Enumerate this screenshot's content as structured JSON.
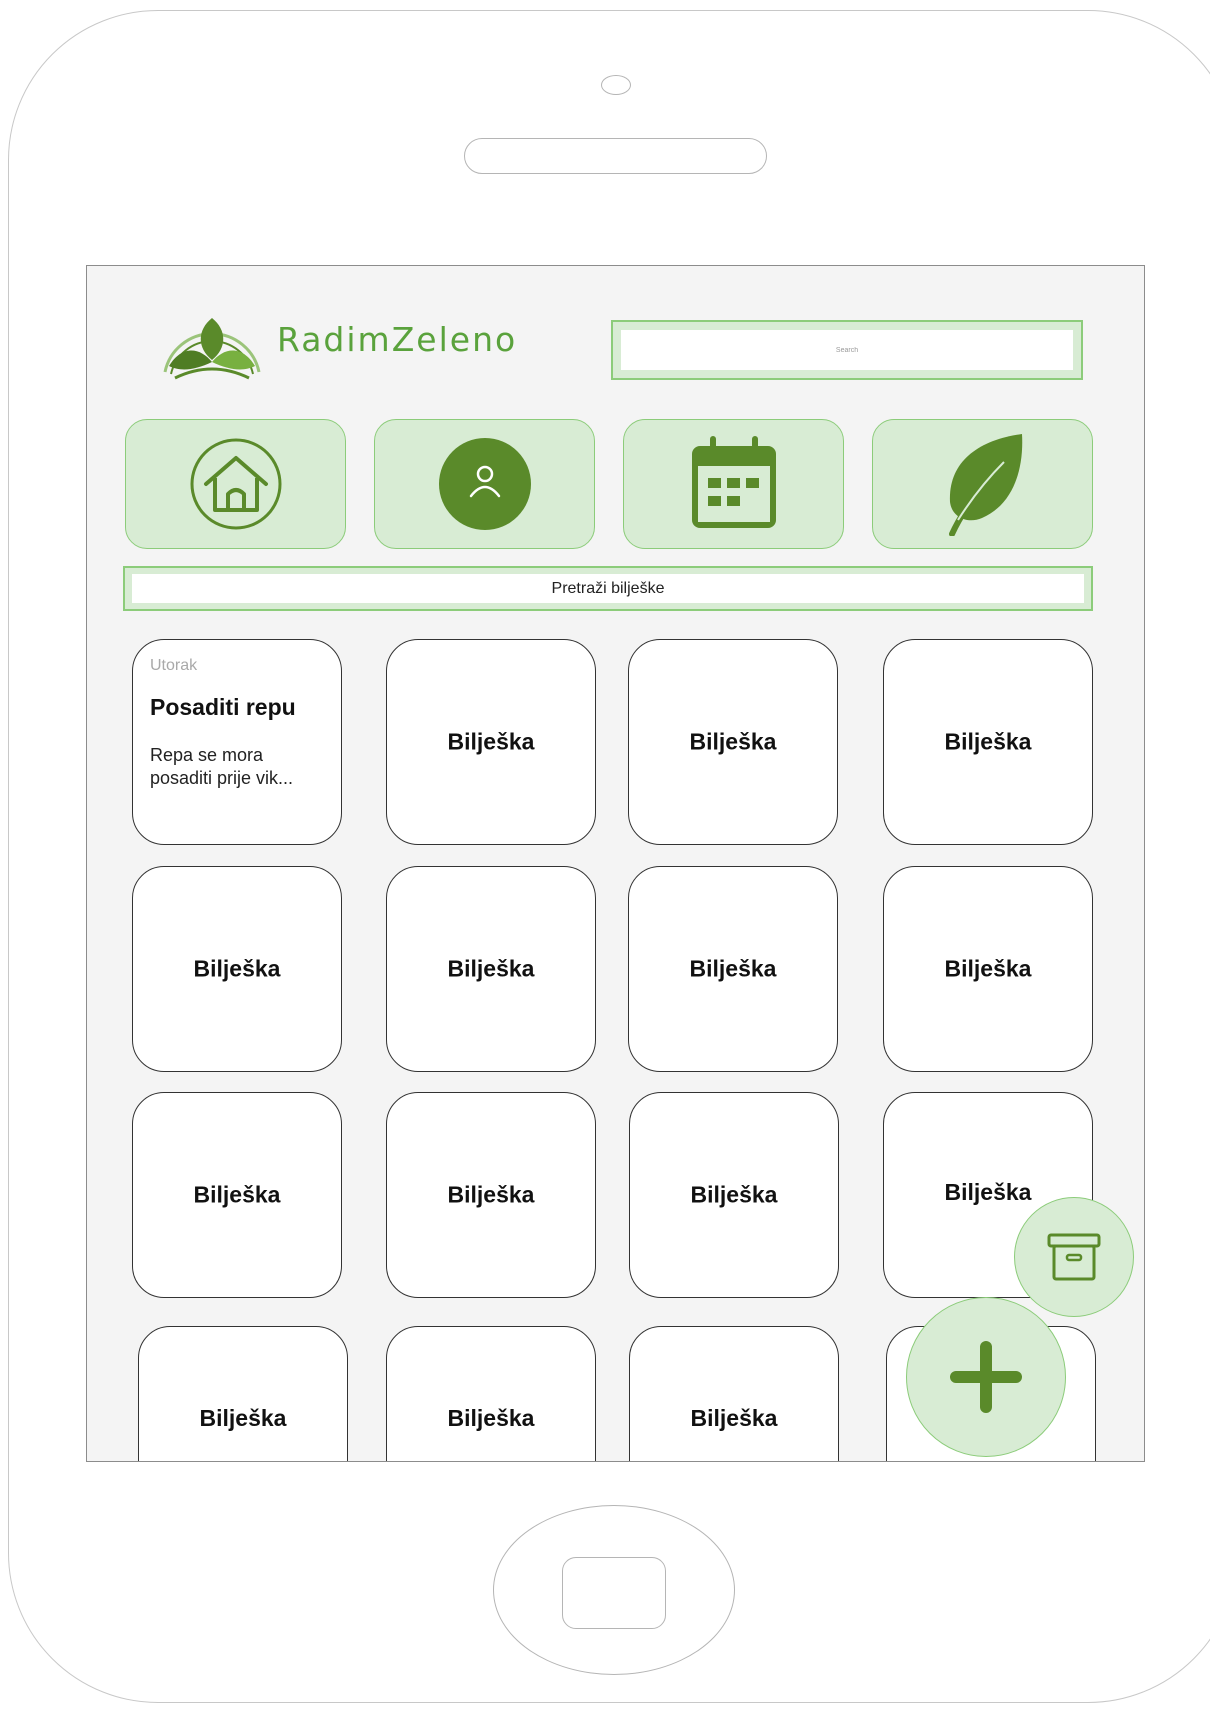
{
  "app": {
    "logo_text": "RadimZeleno"
  },
  "header": {
    "search_placeholder": "Search"
  },
  "nav": [
    {
      "icon": "home-icon"
    },
    {
      "icon": "user-icon"
    },
    {
      "icon": "calendar-icon"
    },
    {
      "icon": "leaf-icon"
    }
  ],
  "notes_search": {
    "label": "Pretraži bilješke"
  },
  "notes": {
    "featured": {
      "day": "Utorak",
      "title": "Posaditi repu",
      "body": "Repa se mora posaditi prije vik..."
    },
    "placeholder_title": "Bilješka"
  },
  "fabs": {
    "archive_icon": "archive-icon",
    "add_icon": "plus-icon"
  },
  "colors": {
    "accent": "#5a8a2a",
    "tile_bg": "#d8ecd4",
    "tile_border": "#8ccc7a",
    "screen_bg": "#f4f4f4"
  }
}
